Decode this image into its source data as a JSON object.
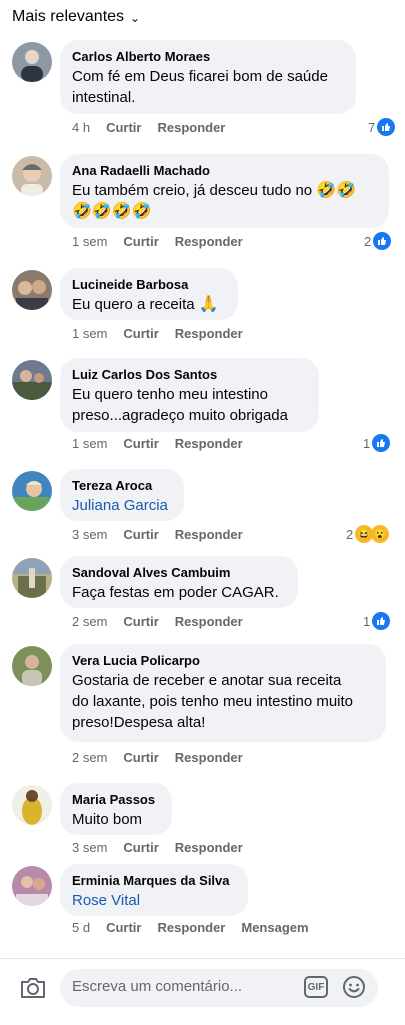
{
  "header": {
    "sort_label": "Mais relevantes"
  },
  "actions": {
    "like": "Curtir",
    "reply": "Responder",
    "message": "Mensagem"
  },
  "comments": [
    {
      "name": "Carlos Alberto Moraes",
      "line1": "Com fé em Deus ficarei bom de saúde",
      "line2": "intestinal.",
      "time": "4 h",
      "reactions": "7",
      "avatar_color": "#6b7a8f"
    },
    {
      "name": "Ana Radaelli Machado",
      "line1": "Eu também creio, já desceu tudo no",
      "line2": "",
      "time": "1 sem",
      "reactions": "2",
      "avatar_color": "#b9a28c"
    },
    {
      "name": "Lucineide Barbosa",
      "line1": "Eu quero a receita",
      "time": "1 sem",
      "avatar_color": "#7b6c5e"
    },
    {
      "name": "Luiz Carlos  Dos Santos",
      "line1": "Eu quero tenho meu intestino",
      "line2": "preso...agradeço muito  obrigada",
      "time": "1 sem",
      "reactions": "1",
      "avatar_color": "#5a6a7c"
    },
    {
      "name": "Tereza Aroca",
      "mention": "Juliana Garcia",
      "time": "3 sem",
      "reactions": "2",
      "avatar_color": "#3a7fb0"
    },
    {
      "name": "Sandoval Alves Cambuim",
      "line1": "Faça festas em poder CAGAR.",
      "time": "2 sem",
      "reactions": "1",
      "avatar_color": "#8a8f6a"
    },
    {
      "name": "Vera Lucia Policarpo",
      "line1": "Gostaria de receber e anotar sua receita",
      "line2": "do laxante, pois tenho meu intestino muito",
      "line3": "preso!Despesa alta!",
      "time": "2 sem",
      "avatar_color": "#7a8b5c"
    },
    {
      "name": "Maria Passos",
      "line1": "Muito bom",
      "time": "3 sem",
      "avatar_color": "#c9b23a"
    },
    {
      "name": "Erminia Marques da Silva",
      "mention": "Rose Vital",
      "time": "5 d",
      "avatar_color": "#a46a8a"
    }
  ],
  "composer": {
    "placeholder": "Escreva um comentário...",
    "gif_label": "GIF"
  },
  "colors": {
    "bubble": "#f0f2f5",
    "like_blue": "#1877f2",
    "mention": "#1a5bb0",
    "meta_gray": "#65676b"
  }
}
